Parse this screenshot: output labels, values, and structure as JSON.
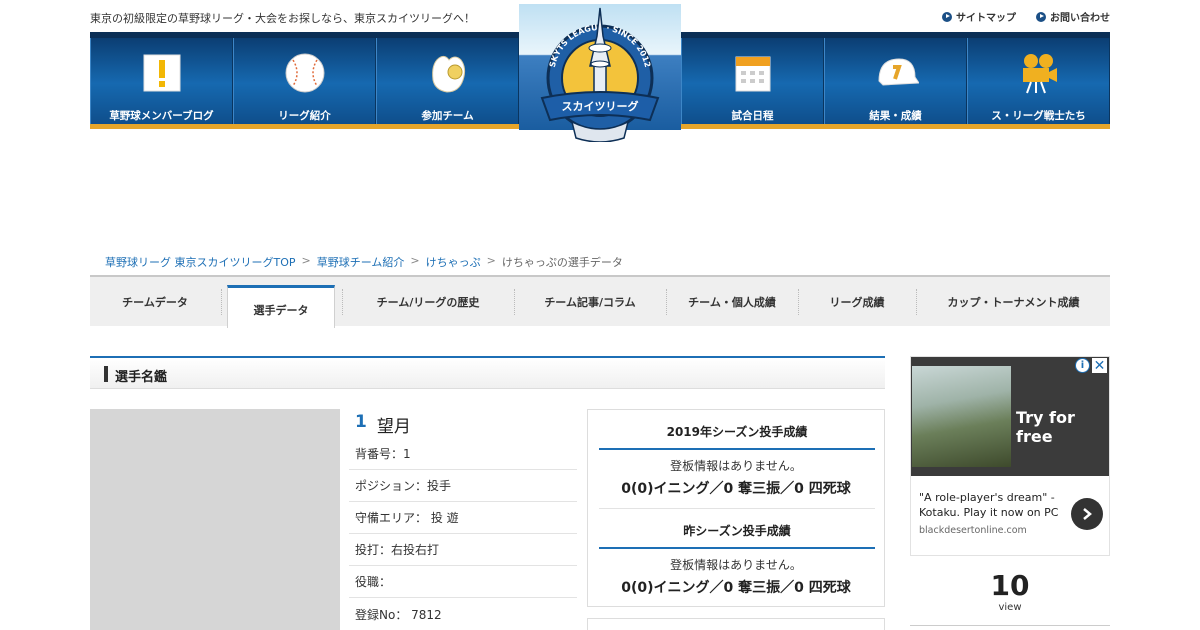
{
  "header": {
    "tagline": "東京の初級限定の草野球リーグ・大会をお探しなら、東京スカイツリーグへ！",
    "links": [
      "サイトマップ",
      "お問い合わせ"
    ]
  },
  "nav": {
    "items": [
      {
        "label": "草野球メンバーブログ",
        "icon": "exclamation-icon"
      },
      {
        "label": "リーグ紹介",
        "icon": "baseball-icon"
      },
      {
        "label": "参加チーム",
        "icon": "glove-icon"
      },
      {
        "label": "試合日程",
        "icon": "calendar-icon"
      },
      {
        "label": "結果・成績",
        "icon": "cap-icon"
      },
      {
        "label": "ス・リーグ戦士たち",
        "icon": "camera-icon"
      }
    ],
    "logo": {
      "arc_text": "SKYTS LEAGUE · SINCE 2012",
      "banner": "スカイツリーグ"
    }
  },
  "breadcrumb": [
    "草野球リーグ 東京スカイツリーグTOP",
    "草野球チーム紹介",
    "けちゃっぷ",
    "けちゃっぷの選手データ"
  ],
  "tabs": [
    "チームデータ",
    "選手データ",
    "チーム/リーグの歴史",
    "チーム記事/コラム",
    "チーム・個人成績",
    "リーグ成績",
    "カップ・トーナメント成績"
  ],
  "active_tab": "選手データ",
  "section": {
    "title": "選手名鑑"
  },
  "player": {
    "number": "1",
    "name": "望月",
    "rows": [
      "背番号：1",
      "ポジション：投手",
      "守備エリア： 投 遊",
      "投打：右投右打",
      "役職：",
      "登録No： 7812"
    ]
  },
  "stats": [
    {
      "title": "2019年シーズン投手成績",
      "message": "登板情報はありません。",
      "line": "0(0)イニング／0 奪三振／0 四死球"
    },
    {
      "title": "昨シーズン投手成績",
      "message": "登板情報はありません。",
      "line": "0(0)イニング／0 奪三振／0 四死球"
    }
  ],
  "ad": {
    "cta": "Try for free",
    "text": "\"A role-player's dream\" - Kotaku. Play it now on PC",
    "domain": "blackdesertonline.com"
  },
  "views": {
    "count": "10",
    "label": "view"
  },
  "colors": {
    "accent": "#1d6fb5",
    "nav": "#1669b0",
    "gold": "#e6a52a"
  }
}
